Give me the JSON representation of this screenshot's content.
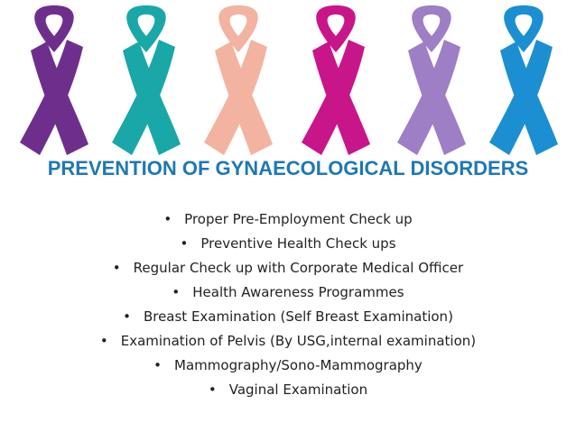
{
  "title": "PREVENTION OF GYNAECOLOGICAL DISORDERS",
  "bullet_glyph": "•",
  "bullets": [
    "Proper Pre-Employment Check up",
    "Preventive Health Check ups",
    "Regular Check up with Corporate Medical Officer",
    "Health Awareness Programmes",
    "Breast Examination (Self Breast Examination)",
    "Examination of Pelvis (By USG,internal examination)",
    "Mammography/Sono-Mammography",
    "Vaginal Examination"
  ],
  "ribbon_colors": [
    "#6e2f8c",
    "#1aa7a8",
    "#f2b3a0",
    "#c8158a",
    "#9e7ec4",
    "#1b8fd2"
  ]
}
